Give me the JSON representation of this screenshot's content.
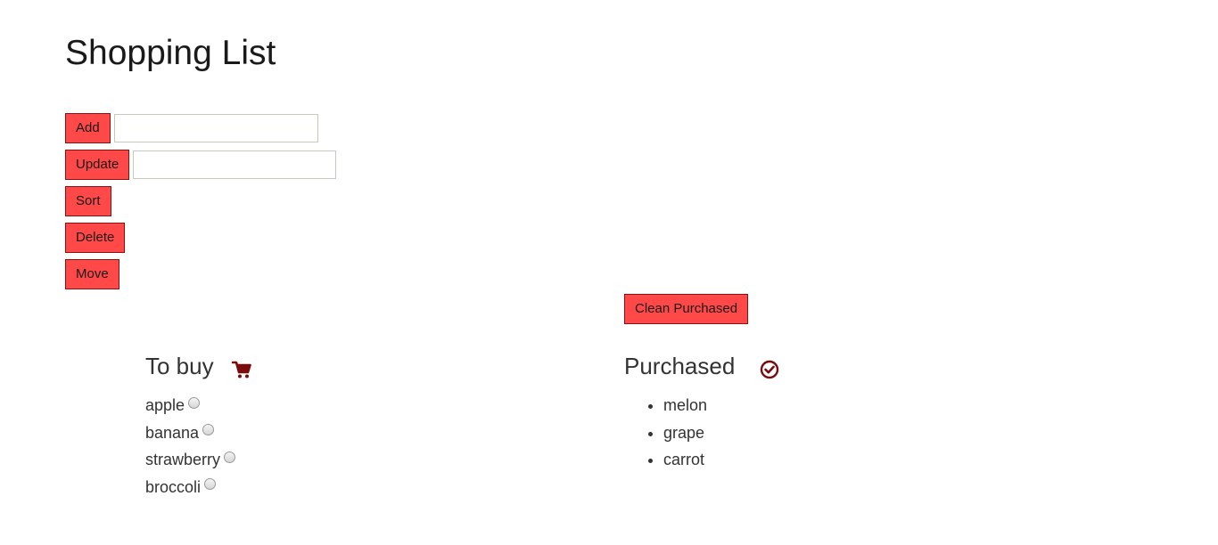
{
  "page": {
    "title": "Shopping List"
  },
  "controls": {
    "add_label": "Add",
    "add_input_value": "",
    "update_label": "Update",
    "update_input_value": "",
    "sort_label": "Sort",
    "delete_label": "Delete",
    "move_label": "Move",
    "clean_purchased_label": "Clean Purchased"
  },
  "to_buy": {
    "title": "To buy",
    "icon": "cart-icon",
    "items": [
      "apple",
      "banana",
      "strawberry",
      "broccoli"
    ]
  },
  "purchased": {
    "title": "Purchased",
    "icon": "check-circle-icon",
    "items": [
      "melon",
      "grape",
      "carrot"
    ]
  },
  "colors": {
    "button_bg": "#ff4848",
    "button_border": "#8b1010",
    "icon_color": "#7a0c0c"
  }
}
